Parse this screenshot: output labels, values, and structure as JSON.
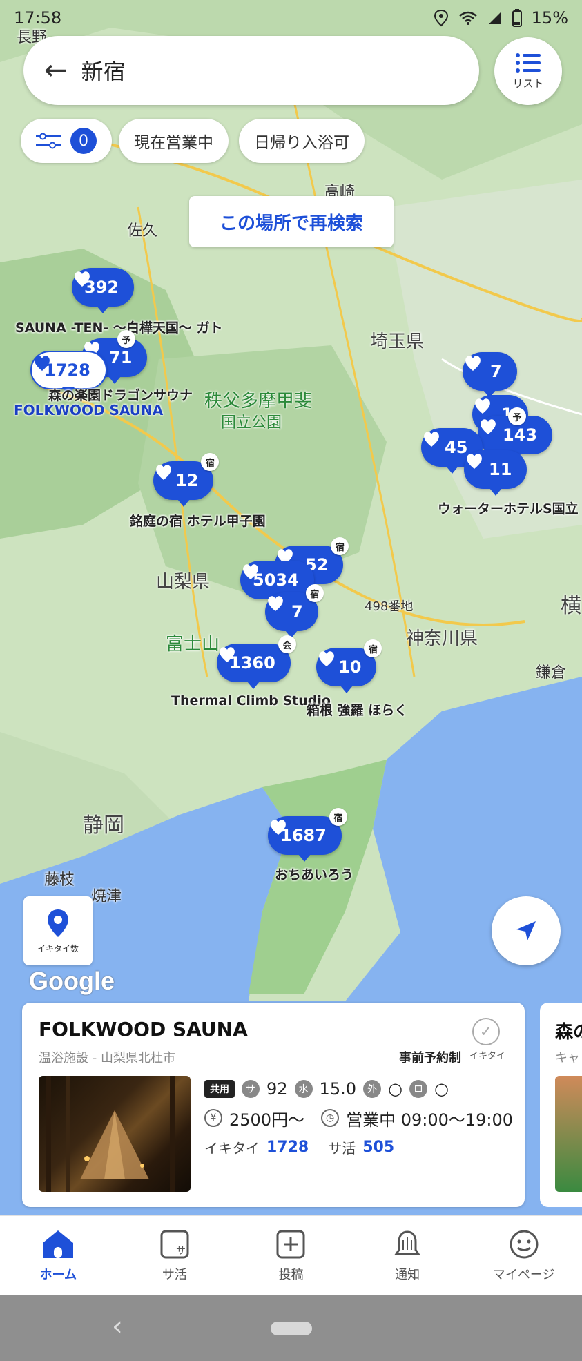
{
  "status_bar": {
    "time": "17:58",
    "battery": "15%"
  },
  "search": {
    "back_icon": "arrow-left-icon",
    "query": "新宿"
  },
  "list_button": {
    "label": "リスト"
  },
  "filters": {
    "count": "0",
    "chips": [
      "現在営業中",
      "日帰り入浴可"
    ]
  },
  "research_button": "この場所で再検索",
  "map_labels": {
    "nagano": "長野",
    "saku": "佐久",
    "takasaki": "高崎",
    "saitama": "埼玉県",
    "chichibu": "秩父多摩甲斐",
    "park": "国立公園",
    "yamanashi": "山梨県",
    "fuji": "富士山",
    "kanagawa": "神奈川県",
    "kamakura": "鎌倉",
    "shizuoka": "静岡",
    "fujieda": "藤枝",
    "yaizu": "焼津",
    "yoko": "横",
    "addr": "498番地"
  },
  "markers": [
    {
      "value": "392",
      "label": "SAUNA -TEN- 〜白樺天国〜 ガト"
    },
    {
      "value": "71",
      "badge": "予"
    },
    {
      "value": "1728",
      "label": "森の楽園ドラゴンサウナ",
      "sublabel": "FOLKWOOD SAUNA",
      "selected": true
    },
    {
      "value": "12",
      "badge": "宿",
      "label": "銘庭の宿 ホテル甲子園"
    },
    {
      "value": "52",
      "badge": "宿"
    },
    {
      "value": "5034"
    },
    {
      "value": "7",
      "badge": "宿"
    },
    {
      "value": "1360",
      "badge": "会",
      "label": "Thermal Climb Studio"
    },
    {
      "value": "10",
      "badge": "宿",
      "label": "箱根 強羅 ほらく"
    },
    {
      "value": "7"
    },
    {
      "value": "1"
    },
    {
      "value": "143",
      "badge": "予"
    },
    {
      "value": "45"
    },
    {
      "value": "11",
      "label": "ウォーターホテルS国立"
    },
    {
      "value": "1687",
      "badge": "宿",
      "label": "おちあいろう"
    }
  ],
  "map_buttons": {
    "ikitai_label": "イキタイ数",
    "google": "Google"
  },
  "card": {
    "title": "FOLKWOOD SAUNA",
    "subtitle": "温浴施設 - 山梨県北杜市",
    "reservation": "事前予約制",
    "ikitai_label": "イキタイ",
    "tag": "共用",
    "sauna_temp": "92",
    "water_temp": "15.0",
    "outside": "○",
    "rest": "○",
    "price": "2500円〜",
    "hours": "営業中 09:00〜19:00",
    "ikitai_count_label": "イキタイ",
    "ikitai_count": "1728",
    "sakatsu_label": "サ活",
    "sakatsu_count": "505",
    "next_card_title": "森の",
    "next_card_sub": "キャ"
  },
  "bottom_nav": [
    {
      "label": "ホーム",
      "icon": "home-icon",
      "active": true
    },
    {
      "label": "サ活",
      "icon": "sakatsu-icon"
    },
    {
      "label": "投稿",
      "icon": "post-icon"
    },
    {
      "label": "通知",
      "icon": "bell-icon"
    },
    {
      "label": "マイページ",
      "icon": "smile-icon"
    }
  ],
  "colors": {
    "accent": "#1e50d8",
    "map_green": "#cfe5c2",
    "sea": "#86b3f0"
  }
}
